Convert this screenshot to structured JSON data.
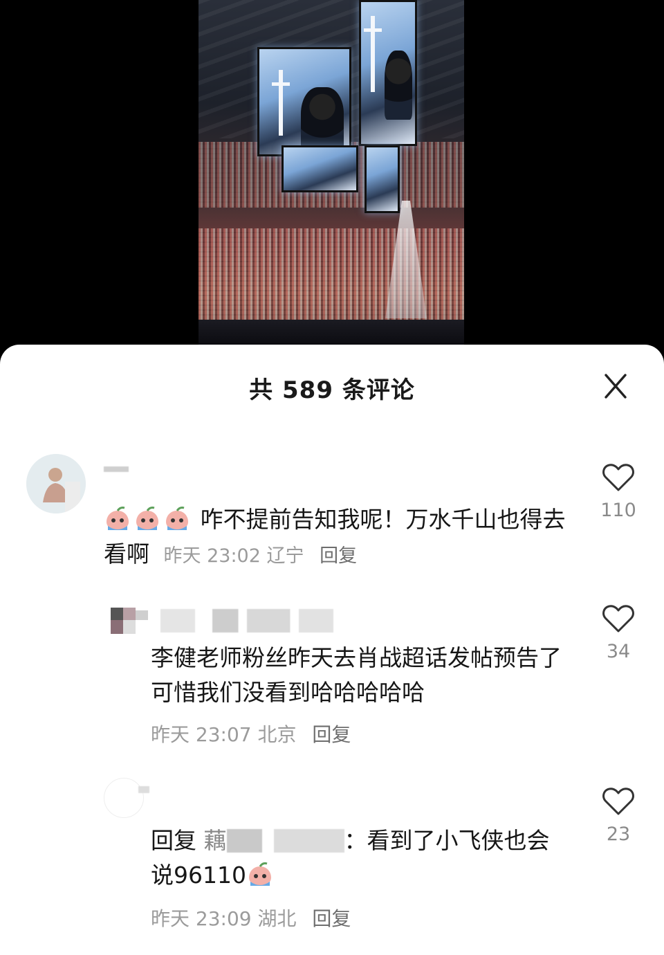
{
  "header": {
    "title": "共 589 条评论"
  },
  "icons": {
    "close": "close-icon",
    "like": "heart-outline-icon",
    "emoji": "crying-peach-emoji"
  },
  "comments": [
    {
      "text": "咋不提前告知我呢！万水千山也得去看啊",
      "emoji_count": 3,
      "time": "昨天 23:02",
      "location": "辽宁",
      "reply_label": "回复",
      "likes": "110"
    },
    {
      "text": "李健老师粉丝昨天去肖战超话发帖预告了 可惜我们没看到哈哈哈哈哈",
      "time": "昨天 23:07",
      "location": "北京",
      "reply_label": "回复",
      "likes": "34"
    },
    {
      "reply_prefix": "回复",
      "reply_to": "藕",
      "text_after": "：看到了小飞侠也会说96110",
      "time": "昨天 23:09",
      "location": "湖北",
      "reply_label": "回复",
      "likes": "23"
    }
  ],
  "colors": {
    "sheet_bg": "#ffffff",
    "text_primary": "#161616",
    "text_secondary": "#9b9b9b",
    "backdrop": "#000000"
  }
}
